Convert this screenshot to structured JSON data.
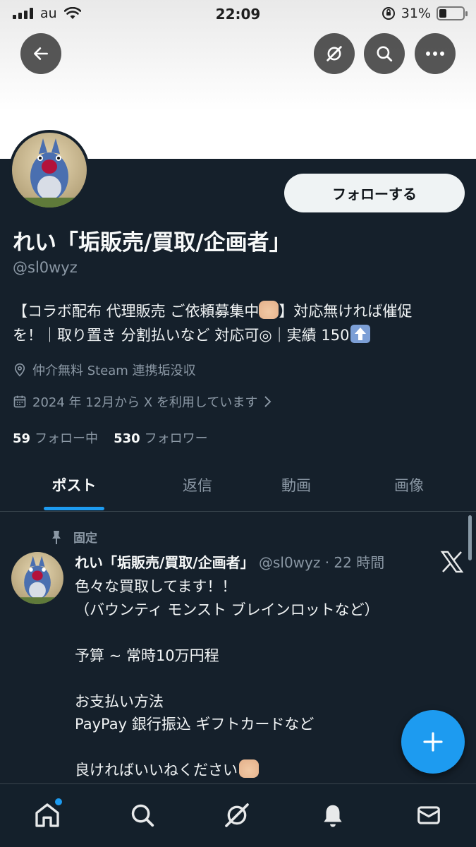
{
  "status_bar": {
    "carrier": "au",
    "time": "22:09",
    "battery": "31%",
    "battery_level": 0.31
  },
  "header_buttons": {
    "back_icon": "arrow-left-icon",
    "grok_icon": "grok-icon",
    "search_icon": "search-icon",
    "more_icon": "more-horizontal-icon"
  },
  "profile": {
    "follow_label": "フォローする",
    "display_name": "れい「垢販売/買取/企画者」",
    "handle": "@sl0wyz",
    "bio_line1_a": "【コラボ配布 代理販売 ご依頼募集中",
    "bio_line1_b": "】対応無ければ催促",
    "bio_line2_a": "を！｜取り置き 分割払いなど 対応可◎｜実績 150",
    "location": "仲介無料 Steam 連携垢没収",
    "joined": "2024 年 12月から X を利用しています",
    "following_count": "59",
    "following_label": "フォロー中",
    "followers_count": "530",
    "followers_label": "フォロワー"
  },
  "tabs": [
    {
      "label": "ポスト"
    },
    {
      "label": "返信"
    },
    {
      "label": "動画"
    },
    {
      "label": "画像"
    }
  ],
  "post": {
    "pinned_label": "固定",
    "author_name": "れい「垢販売/買取/企画者」",
    "author_meta": "@sl0wyz · 22 時間",
    "body": "色々な買取してます！！\n（バウンティ モンスト ブレインロットなど）\n\n予算 ~ 常時10万円程\n\nお支払い方法\nPayPay 銀行振込 ギフトカードなど\n\n良ければいいねください"
  },
  "colors": {
    "background": "#15202b",
    "accent": "#1d9bf0",
    "muted": "#8b98a5"
  }
}
